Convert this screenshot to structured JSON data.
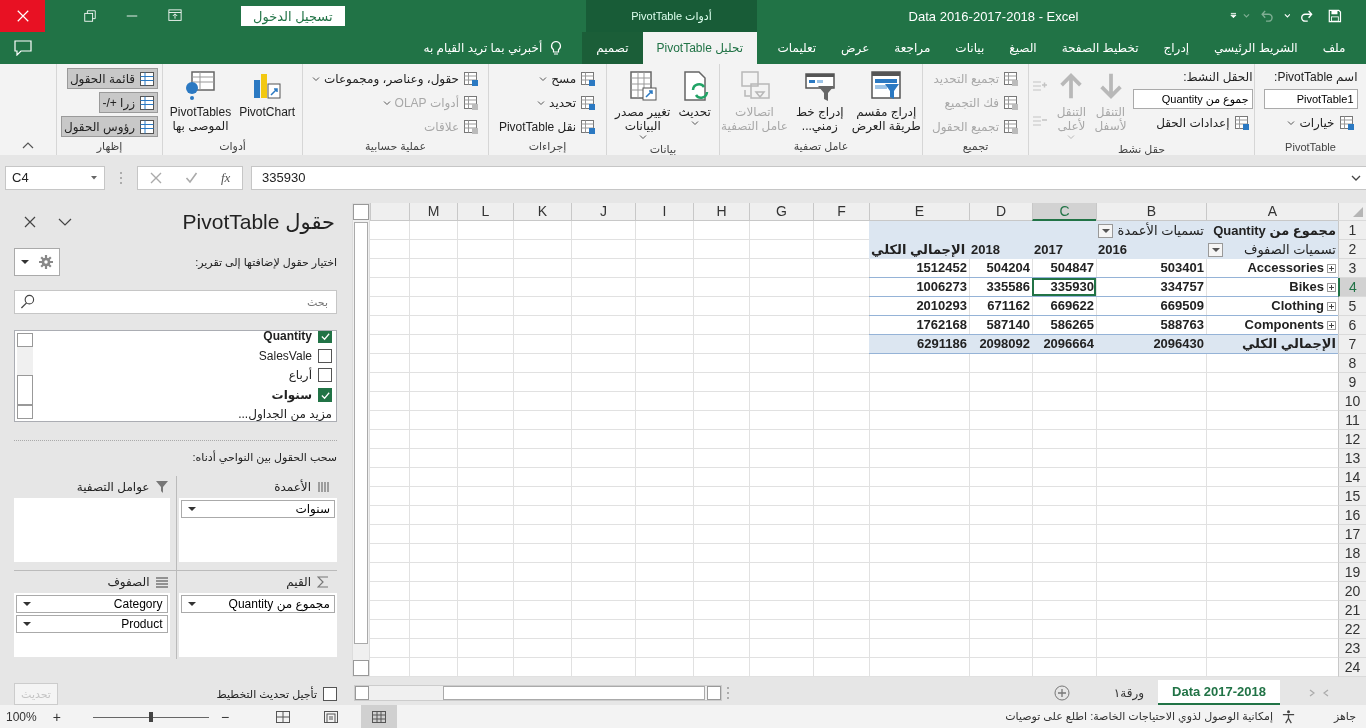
{
  "title_bar": {
    "title": "Data 2016-2017-2018  -  Excel",
    "context_header": "أدوات PivotTable",
    "sign_in": "تسجيل الدخول"
  },
  "tabs": [
    {
      "label": "ملف",
      "selected": false,
      "contextual": false
    },
    {
      "label": "الشريط الرئيسي",
      "selected": false,
      "contextual": false
    },
    {
      "label": "إدراج",
      "selected": false,
      "contextual": false
    },
    {
      "label": "تخطيط الصفحة",
      "selected": false,
      "contextual": false
    },
    {
      "label": "الصيغ",
      "selected": false,
      "contextual": false
    },
    {
      "label": "بيانات",
      "selected": false,
      "contextual": false
    },
    {
      "label": "مراجعة",
      "selected": false,
      "contextual": false
    },
    {
      "label": "عرض",
      "selected": false,
      "contextual": false
    },
    {
      "label": "تعليمات",
      "selected": false,
      "contextual": false
    },
    {
      "label": "تحليل PivotTable",
      "selected": true,
      "contextual": true
    },
    {
      "label": "تصميم",
      "selected": false,
      "contextual": true
    }
  ],
  "tell_me": "أخبرني بما تريد القيام به",
  "ribbon": {
    "groups": [
      {
        "label": "PivotTable",
        "columns": [
          [
            {
              "kind": "caption",
              "label": "اسم PivotTable:"
            },
            {
              "kind": "field",
              "value": "PivotTable1"
            },
            {
              "kind": "small",
              "label": "خيارات",
              "dropdown": true,
              "disabled": false
            }
          ]
        ]
      },
      {
        "label": "حقل نشط",
        "columns": [
          [
            {
              "kind": "caption",
              "label": "الحقل النشط:"
            },
            {
              "kind": "field",
              "value": "جموع من Quantity"
            },
            {
              "kind": "small",
              "label": "إعدادات الحقل",
              "dropdown": false,
              "disabled": false
            }
          ],
          [
            {
              "kind": "large",
              "lines": [
                "التنقل",
                "لأسفل"
              ],
              "dropdown": false,
              "disabled": true
            }
          ],
          [
            {
              "kind": "large",
              "lines": [
                "التنقل",
                "لأعلى"
              ],
              "dropdown": true,
              "disabled": true
            }
          ],
          [
            {
              "kind": "icon",
              "disabled": true
            },
            {
              "kind": "icon",
              "disabled": true
            }
          ]
        ]
      },
      {
        "label": "تجميع",
        "columns": [
          [
            {
              "kind": "small",
              "label": "تجميع التحديد",
              "dropdown": false,
              "disabled": true
            },
            {
              "kind": "small",
              "label": "فك التجميع",
              "dropdown": false,
              "disabled": true
            },
            {
              "kind": "small",
              "label": "تجميع الحقول",
              "dropdown": false,
              "disabled": true
            }
          ]
        ]
      },
      {
        "label": "عامل تصفية",
        "columns": [
          [
            {
              "kind": "large",
              "lines": [
                "إدراج مقسم",
                "طريقة العرض"
              ],
              "dropdown": false,
              "disabled": false
            }
          ],
          [
            {
              "kind": "large",
              "lines": [
                "إدراج خط",
                "زمني..."
              ],
              "dropdown": false,
              "disabled": false
            }
          ],
          [
            {
              "kind": "large",
              "lines": [
                "اتصالات",
                "عامل التصفية"
              ],
              "dropdown": false,
              "disabled": true
            }
          ]
        ]
      },
      {
        "label": "بيانات",
        "columns": [
          [
            {
              "kind": "large",
              "lines": [
                "تحديث"
              ],
              "dropdown": true,
              "disabled": false
            }
          ],
          [
            {
              "kind": "large",
              "lines": [
                "تغيير مصدر",
                "البيانات"
              ],
              "dropdown": true,
              "disabled": false
            }
          ]
        ]
      },
      {
        "label": "إجراءات",
        "columns": [
          [
            {
              "kind": "small",
              "label": "مسح",
              "dropdown": true,
              "disabled": false
            },
            {
              "kind": "small",
              "label": "تحديد",
              "dropdown": true,
              "disabled": false
            },
            {
              "kind": "small",
              "label": "نقل PivotTable",
              "dropdown": false,
              "disabled": false
            }
          ]
        ]
      },
      {
        "label": "عملية حسابية",
        "columns": [
          [
            {
              "kind": "small",
              "label": "حقول، وعناصر، ومجموعات",
              "dropdown": true,
              "disabled": false
            },
            {
              "kind": "small",
              "label": "أدوات OLAP",
              "dropdown": true,
              "disabled": true
            },
            {
              "kind": "small",
              "label": "علاقات",
              "dropdown": false,
              "disabled": true
            }
          ]
        ]
      },
      {
        "label": "أدوات",
        "columns": [
          [
            {
              "kind": "large",
              "lines": [
                "PivotChart"
              ],
              "dropdown": false,
              "disabled": false
            }
          ],
          [
            {
              "kind": "large",
              "lines": [
                "PivotTables",
                "الموصى بها"
              ],
              "dropdown": false,
              "disabled": false
            }
          ]
        ]
      },
      {
        "label": "إظهار",
        "columns": [
          [
            {
              "kind": "toggle",
              "label": "قائمة الحقول",
              "on": true
            },
            {
              "kind": "toggle",
              "label": "زرا +/-",
              "on": true
            },
            {
              "kind": "toggle",
              "label": "رؤوس الحقول",
              "on": true
            }
          ]
        ]
      }
    ]
  },
  "formula_bar": {
    "name_box": "C4",
    "function_label": "fx",
    "value": "335930"
  },
  "field_pane": {
    "title": "حقول PivotTable",
    "instruction": "اختيار حقول لإضافتها إلى تقرير:",
    "search_placeholder": "بحث",
    "fields": [
      {
        "label": "Quantity",
        "checked": true
      },
      {
        "label": "SalesVale",
        "checked": false
      },
      {
        "label": "أرباع",
        "checked": false
      },
      {
        "label": "سنوات",
        "checked": true
      }
    ],
    "more_tables": "مزيد من الجداول...",
    "drag_hint": "سحب الحقول بين النواحي أدناه:",
    "areas": [
      {
        "kind": "columns",
        "title": "الأعمدة",
        "items": [
          "سنوات"
        ]
      },
      {
        "kind": "filters",
        "title": "عوامل التصفية"
      },
      {
        "kind": "values",
        "title": "القيم",
        "items": [
          "مجموع من Quantity"
        ]
      },
      {
        "kind": "rows",
        "title": "الصفوف",
        "items": [
          "Category",
          "Product"
        ]
      }
    ],
    "defer_update": {
      "label": "تأجيل تحديث التخطيط",
      "checked": false
    },
    "update_button": {
      "label": "تحديث",
      "disabled": true
    }
  },
  "grid": {
    "columns": [
      {
        "label": "A",
        "selected": false
      },
      {
        "label": "B",
        "selected": false
      },
      {
        "label": "C",
        "selected": true
      },
      {
        "label": "D",
        "selected": false
      },
      {
        "label": "E",
        "selected": false
      },
      {
        "label": "F",
        "selected": false
      },
      {
        "label": "G",
        "selected": false
      },
      {
        "label": "H",
        "selected": false
      },
      {
        "label": "I",
        "selected": false
      },
      {
        "label": "J",
        "selected": false
      },
      {
        "label": "K",
        "selected": false
      },
      {
        "label": "L",
        "selected": false
      },
      {
        "label": "M",
        "selected": false
      }
    ],
    "rows": [
      {
        "label": "1",
        "selected": false
      },
      {
        "label": "2",
        "selected": false
      },
      {
        "label": "3",
        "selected": false
      },
      {
        "label": "4",
        "selected": true
      },
      {
        "label": "5",
        "selected": false
      },
      {
        "label": "6",
        "selected": false
      },
      {
        "label": "7",
        "selected": false
      },
      {
        "label": "8",
        "selected": false
      },
      {
        "label": "9",
        "selected": false
      },
      {
        "label": "10",
        "selected": false
      },
      {
        "label": "11",
        "selected": false
      },
      {
        "label": "12",
        "selected": false
      },
      {
        "label": "13",
        "selected": false
      },
      {
        "label": "14",
        "selected": false
      },
      {
        "label": "15",
        "selected": false
      },
      {
        "label": "16",
        "selected": false
      },
      {
        "label": "17",
        "selected": false
      },
      {
        "label": "18",
        "selected": false
      },
      {
        "label": "19",
        "selected": false
      },
      {
        "label": "20",
        "selected": false
      },
      {
        "label": "21",
        "selected": false
      },
      {
        "label": "22",
        "selected": false
      },
      {
        "label": "23",
        "selected": false
      },
      {
        "label": "24",
        "selected": false
      }
    ]
  },
  "pivot": {
    "title": "مجموع من Quantity",
    "column_labels": "تسميات الأعمدة",
    "row_labels": "تسميات الصفوف",
    "headers": [
      "2016",
      "2017",
      "2018",
      "الإجمالي الكلي"
    ],
    "rows": [
      {
        "label": "Accessories",
        "cells": [
          {
            "value": "503401",
            "selected": false
          },
          {
            "value": "504847",
            "selected": false
          },
          {
            "value": "504204",
            "selected": false
          },
          {
            "value": "1512452",
            "selected": false
          }
        ]
      },
      {
        "label": "Bikes",
        "cells": [
          {
            "value": "334757",
            "selected": false
          },
          {
            "value": "335930",
            "selected": true
          },
          {
            "value": "335586",
            "selected": false
          },
          {
            "value": "1006273",
            "selected": false
          }
        ]
      },
      {
        "label": "Clothing",
        "cells": [
          {
            "value": "669509",
            "selected": false
          },
          {
            "value": "669622",
            "selected": false
          },
          {
            "value": "671162",
            "selected": false
          },
          {
            "value": "2010293",
            "selected": false
          }
        ]
      },
      {
        "label": "Components",
        "cells": [
          {
            "value": "588763",
            "selected": false
          },
          {
            "value": "586265",
            "selected": false
          },
          {
            "value": "587140",
            "selected": false
          },
          {
            "value": "1762168",
            "selected": false
          }
        ]
      }
    ],
    "total": {
      "label": "الإجمالي الكلي",
      "values": [
        "2096430",
        "2096664",
        "2098092",
        "6291186"
      ]
    }
  },
  "sheet_tabs": [
    {
      "label": "Data 2017-2018",
      "selected": true
    },
    {
      "label": "ورقة١",
      "selected": false
    }
  ],
  "status_bar": {
    "status": "جاهز",
    "accessibility": "إمكانية الوصول لذوي الاحتياجات الخاصة: اطلع على توصيات",
    "views": [
      {
        "kind": "normal",
        "selected": true
      },
      {
        "kind": "page_layout",
        "selected": false
      },
      {
        "kind": "page_break",
        "selected": false
      }
    ],
    "zoom": {
      "minus": "−",
      "plus": "+",
      "level": 0.5,
      "label": "100%"
    }
  }
}
